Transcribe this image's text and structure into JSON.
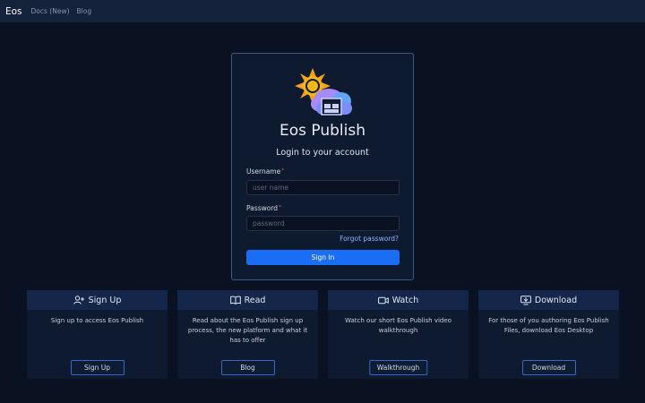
{
  "navbar": {
    "brand": "Eos",
    "links": [
      "Docs (New)",
      "Blog"
    ]
  },
  "login": {
    "app_title": "Eos Publish",
    "subtitle": "Login to your account",
    "username_label": "Username",
    "username_placeholder": "user name",
    "required_mark": "*",
    "password_label": "Password",
    "password_placeholder": "password",
    "forgot_label": "Forgot password?",
    "signin_label": "Sign In"
  },
  "features": [
    {
      "title": "Sign Up",
      "icon": "person-add-icon",
      "description": "Sign up to access Eos Publish",
      "button": "Sign Up"
    },
    {
      "title": "Read",
      "icon": "book-icon",
      "description": "Read about the Eos Publish sign up process, the new platform and what it has to offer",
      "button": "Blog"
    },
    {
      "title": "Watch",
      "icon": "video-icon",
      "description": "Watch our short Eos Publish video walkthrough",
      "button": "Walkthrough"
    },
    {
      "title": "Download",
      "icon": "download-icon",
      "description": "For those of you authoring Eos Publish Files, download Eos Desktop",
      "button": "Download"
    }
  ],
  "colors": {
    "background": "#0a1120",
    "navbar": "#14223b",
    "accent": "#1a6ef5",
    "card_border": "#3b5a94",
    "required": "#e5484d",
    "link": "#8ab4ff"
  }
}
